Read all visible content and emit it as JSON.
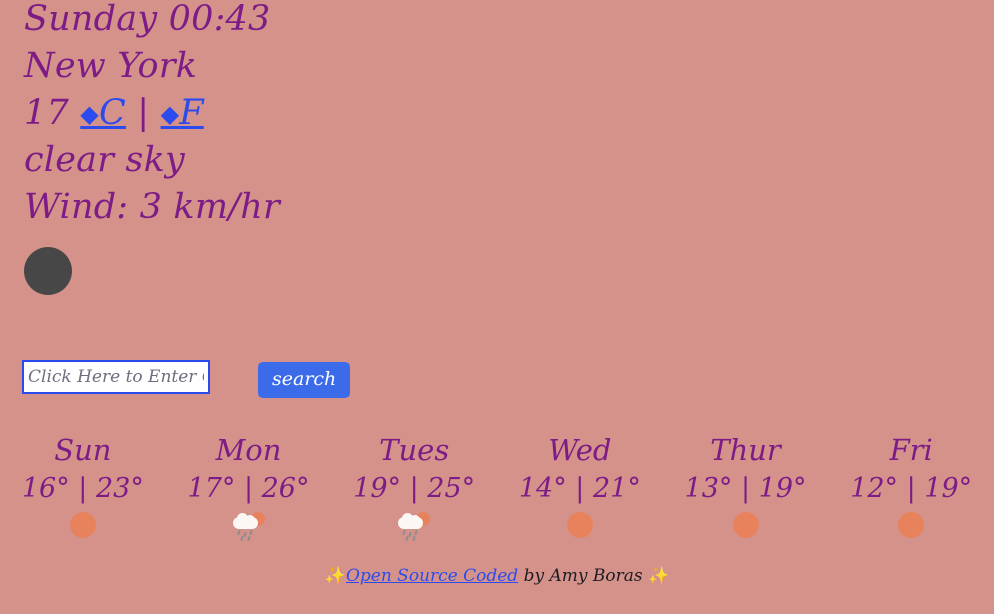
{
  "theme": {
    "background": "#D4928A",
    "text_purple": "#7D1C86",
    "link_blue": "#2C4BEE",
    "button_blue": "#3B6BE8",
    "sun_orange": "#E8825C",
    "circle_gray": "#474747",
    "cloud_white": "#FAF7F4",
    "footer_text": "#1C1C22",
    "sparkle_yellow": "#F5D04A"
  },
  "current": {
    "datetime": "Sunday 00:43",
    "city": "New York",
    "temperature": "17",
    "unit_celsius_glyph": "◆",
    "unit_celsius_label": "C",
    "unit_separator": "|",
    "unit_fahrenheit_glyph": "◆",
    "unit_fahrenheit_label": "F",
    "description": "clear sky",
    "wind": "Wind: 3 km/hr"
  },
  "toggle": {
    "name": "theme-toggle-circle"
  },
  "search": {
    "value": "",
    "placeholder": "Click Here to Enter City",
    "button_label": "search"
  },
  "forecast": {
    "days": [
      {
        "name": "Sun",
        "temps": "16° | 23°",
        "low": 16,
        "high": 23,
        "icon": "sun-icon",
        "condition": "clear"
      },
      {
        "name": "Mon",
        "temps": "17° | 26°",
        "low": 17,
        "high": 26,
        "icon": "rain-sun-icon",
        "condition": "rain with sun"
      },
      {
        "name": "Tues",
        "temps": "19° | 25°",
        "low": 19,
        "high": 25,
        "icon": "rain-sun-icon",
        "condition": "rain with sun"
      },
      {
        "name": "Wed",
        "temps": "14° | 21°",
        "low": 14,
        "high": 21,
        "icon": "sun-icon",
        "condition": "clear"
      },
      {
        "name": "Thur",
        "temps": "13° | 19°",
        "low": 13,
        "high": 19,
        "icon": "sun-icon",
        "condition": "clear"
      },
      {
        "name": "Fri",
        "temps": "12° | 19°",
        "low": 12,
        "high": 19,
        "icon": "sun-icon",
        "condition": "clear"
      }
    ]
  },
  "footer": {
    "sparkle_left": "✨",
    "link_text": "Open Source Coded",
    "by_text": " by Amy Boras ",
    "sparkle_right": "✨"
  }
}
